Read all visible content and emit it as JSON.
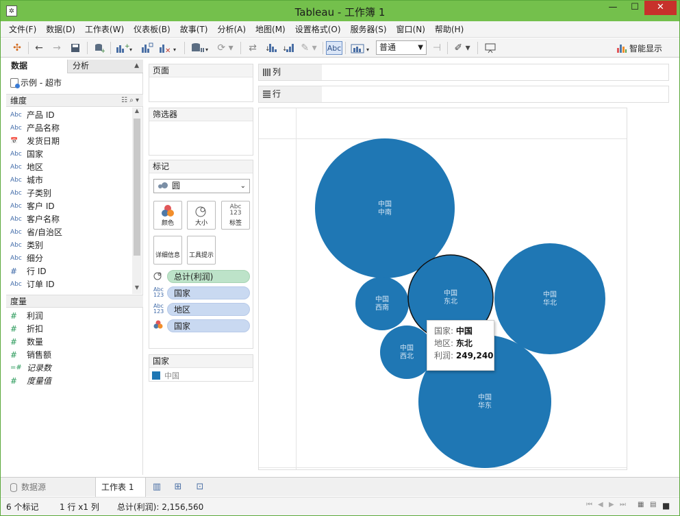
{
  "window": {
    "title": "Tableau - 工作簿 1",
    "min_glyph": "—",
    "max_glyph": "☐",
    "close_glyph": "✕"
  },
  "menu": [
    "文件(F)",
    "数据(D)",
    "工作表(W)",
    "仪表板(B)",
    "故事(T)",
    "分析(A)",
    "地图(M)",
    "设置格式(O)",
    "服务器(S)",
    "窗口(N)",
    "帮助(H)"
  ],
  "toolbar": {
    "abc_label": "Abc",
    "fit_value": "普通",
    "show_me_label": "智能显示"
  },
  "data_pane": {
    "tab_data": "数据",
    "tab_analysis": "分析",
    "datasource": "示例 - 超市",
    "dimensions_header": "维度",
    "dimensions": [
      {
        "type": "Abc",
        "name": "产品 ID"
      },
      {
        "type": "Abc",
        "name": "产品名称"
      },
      {
        "type": "date",
        "name": "发货日期"
      },
      {
        "type": "Abc",
        "name": "国家"
      },
      {
        "type": "Abc",
        "name": "地区"
      },
      {
        "type": "Abc",
        "name": "城市"
      },
      {
        "type": "Abc",
        "name": "子类别"
      },
      {
        "type": "Abc",
        "name": "客户 ID"
      },
      {
        "type": "Abc",
        "name": "客户名称"
      },
      {
        "type": "Abc",
        "name": "省/自治区"
      },
      {
        "type": "Abc",
        "name": "类别"
      },
      {
        "type": "Abc",
        "name": "细分"
      },
      {
        "type": "#",
        "name": "行 ID"
      },
      {
        "type": "Abc",
        "name": "订单 ID"
      }
    ],
    "measures_header": "度量",
    "measures": [
      {
        "type": "#",
        "name": "利润",
        "italic": false
      },
      {
        "type": "#",
        "name": "折扣",
        "italic": false
      },
      {
        "type": "#",
        "name": "数量",
        "italic": false
      },
      {
        "type": "#",
        "name": "销售额",
        "italic": false
      },
      {
        "type": "=#",
        "name": "记录数",
        "italic": true
      },
      {
        "type": "#",
        "name": "度量值",
        "italic": true
      }
    ]
  },
  "cards": {
    "pages_title": "页面",
    "filters_title": "筛选器",
    "marks_title": "标记",
    "mark_type": "圆",
    "buttons": {
      "color": "颜色",
      "size": "大小",
      "label": "标签",
      "detail": "详细信息",
      "tooltip": "工具提示"
    },
    "size_pill": "总计(利润)",
    "label_pills": [
      "国家",
      "地区"
    ],
    "color_pill": "国家",
    "legend_title": "国家",
    "legend_item": "中国"
  },
  "shelves": {
    "columns": "列",
    "rows": "行"
  },
  "bubbles": [
    {
      "country": "中国",
      "region": "中南",
      "color": "#1f77b4",
      "highlighted": false
    },
    {
      "country": "中国",
      "region": "西南",
      "color": "#1f77b4",
      "highlighted": false
    },
    {
      "country": "中国",
      "region": "东北",
      "color": "#1f77b4",
      "highlighted": true
    },
    {
      "country": "中国",
      "region": "华北",
      "color": "#1f77b4",
      "highlighted": false
    },
    {
      "country": "中国",
      "region": "西北",
      "color": "#1f77b4",
      "highlighted": false
    },
    {
      "country": "中国",
      "region": "华东",
      "color": "#1f77b4",
      "highlighted": false
    }
  ],
  "tooltip": {
    "k_country": "国家:",
    "v_country": "中国",
    "k_region": "地区:",
    "v_region": "东北",
    "k_profit": "利润:",
    "v_profit": "249,240"
  },
  "bottom": {
    "datasource_tab": "数据源",
    "sheet_tab": "工作表 1"
  },
  "status": {
    "marks": "6 个标记",
    "rows_cols": "1 行 x1 列",
    "sum": "总计(利润): 2,156,560"
  },
  "colors": {
    "title_bar": "#74c04c",
    "bubble": "#1f77b4",
    "close_button": "#c7312b"
  }
}
